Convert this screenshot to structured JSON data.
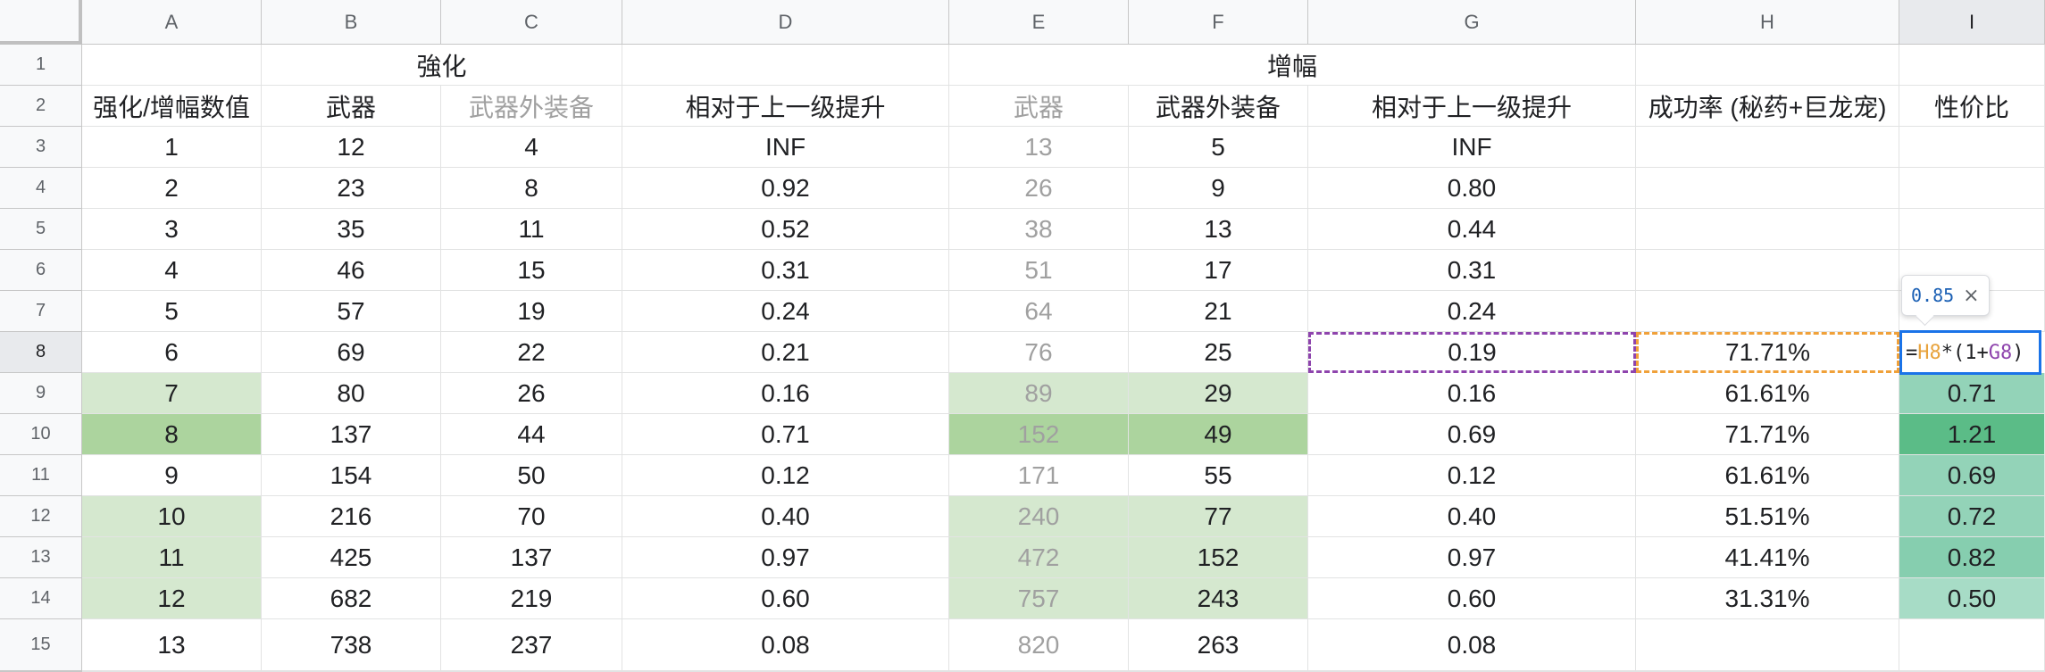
{
  "columns": [
    "A",
    "B",
    "C",
    "D",
    "E",
    "F",
    "G",
    "H",
    "I"
  ],
  "row_numbers": [
    "1",
    "2",
    "3",
    "4",
    "5",
    "6",
    "7",
    "8",
    "9",
    "10",
    "11",
    "12",
    "13",
    "14",
    "15"
  ],
  "merged_headers": {
    "strengthen": "強化",
    "amplify": "增幅"
  },
  "header_row2": [
    "强化/增幅数值",
    "武器",
    "武器外装备",
    "相对于上一级提升",
    "武器",
    "武器外装备",
    "相对于上一级提升",
    "成功率 (秘药+巨龙宠)",
    "性价比"
  ],
  "rows": [
    [
      "1",
      "12",
      "4",
      "INF",
      "13",
      "5",
      "INF",
      "",
      ""
    ],
    [
      "2",
      "23",
      "8",
      "0.92",
      "26",
      "9",
      "0.80",
      "",
      ""
    ],
    [
      "3",
      "35",
      "11",
      "0.52",
      "38",
      "13",
      "0.44",
      "",
      ""
    ],
    [
      "4",
      "46",
      "15",
      "0.31",
      "51",
      "17",
      "0.31",
      "",
      ""
    ],
    [
      "5",
      "57",
      "19",
      "0.24",
      "64",
      "21",
      "0.24",
      "",
      ""
    ],
    [
      "6",
      "69",
      "22",
      "0.21",
      "76",
      "25",
      "0.19",
      "71.71%",
      ""
    ],
    [
      "7",
      "80",
      "26",
      "0.16",
      "89",
      "29",
      "0.16",
      "61.61%",
      "0.71"
    ],
    [
      "8",
      "137",
      "44",
      "0.71",
      "152",
      "49",
      "0.69",
      "71.71%",
      "1.21"
    ],
    [
      "9",
      "154",
      "50",
      "0.12",
      "171",
      "55",
      "0.12",
      "61.61%",
      "0.69"
    ],
    [
      "10",
      "216",
      "70",
      "0.40",
      "240",
      "77",
      "0.40",
      "51.51%",
      "0.72"
    ],
    [
      "11",
      "425",
      "137",
      "0.97",
      "472",
      "152",
      "0.97",
      "41.41%",
      "0.82"
    ],
    [
      "12",
      "682",
      "219",
      "0.60",
      "757",
      "243",
      "0.60",
      "31.31%",
      "0.50"
    ],
    [
      "13",
      "738",
      "237",
      "0.08",
      "820",
      "263",
      "0.08",
      "",
      ""
    ]
  ],
  "formula": {
    "prefix": "=",
    "ref1": "H8",
    "op": "*(1+",
    "ref2": "G8",
    "suffix": ")"
  },
  "formula_tooltip": {
    "value": "0.85",
    "close": "×"
  },
  "colors": {
    "green_light": "#d5e8cf",
    "green_mid": "#acd49e",
    "teal_light": "#a7dcc6",
    "teal_mid": "#93d3b8",
    "teal_strong": "#86ceaf",
    "teal_dark": "#5bbc87",
    "select_blue": "#1a73e8"
  }
}
